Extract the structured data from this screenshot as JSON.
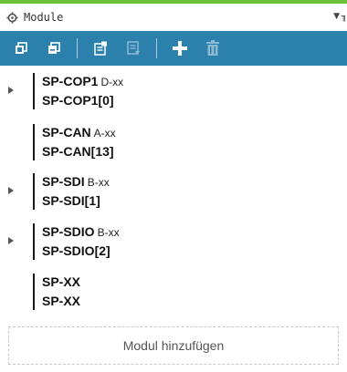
{
  "panel": {
    "title": "Module",
    "title_icon": "gear-icon",
    "dropdown_icon": "triangle-down-icon",
    "pin_icon": "pin-icon",
    "accent_color": "#6cc33a"
  },
  "toolbar": {
    "background": "#2b80ac",
    "buttons": [
      {
        "name": "expand-all-icon",
        "enabled": true
      },
      {
        "name": "collapse-all-icon",
        "enabled": true
      },
      {
        "name": "properties-icon",
        "enabled": true
      },
      {
        "name": "module-settings-icon",
        "enabled": false
      },
      {
        "name": "add-icon",
        "enabled": true
      },
      {
        "name": "trash-icon",
        "enabled": false
      }
    ]
  },
  "modules": [
    {
      "name": "SP-COP1",
      "suffix": "D-xx",
      "instance": "SP-COP1[0]",
      "expandable": true
    },
    {
      "name": "SP-CAN",
      "suffix": "A-xx",
      "instance": "SP-CAN[13]",
      "expandable": false
    },
    {
      "name": "SP-SDI",
      "suffix": "B-xx",
      "instance": "SP-SDI[1]",
      "expandable": true
    },
    {
      "name": "SP-SDIO",
      "suffix": "B-xx",
      "instance": "SP-SDIO[2]",
      "expandable": true
    },
    {
      "name": "SP-XX",
      "suffix": "",
      "instance": "SP-XX",
      "expandable": false
    }
  ],
  "add_module_label": "Modul hinzufügen"
}
